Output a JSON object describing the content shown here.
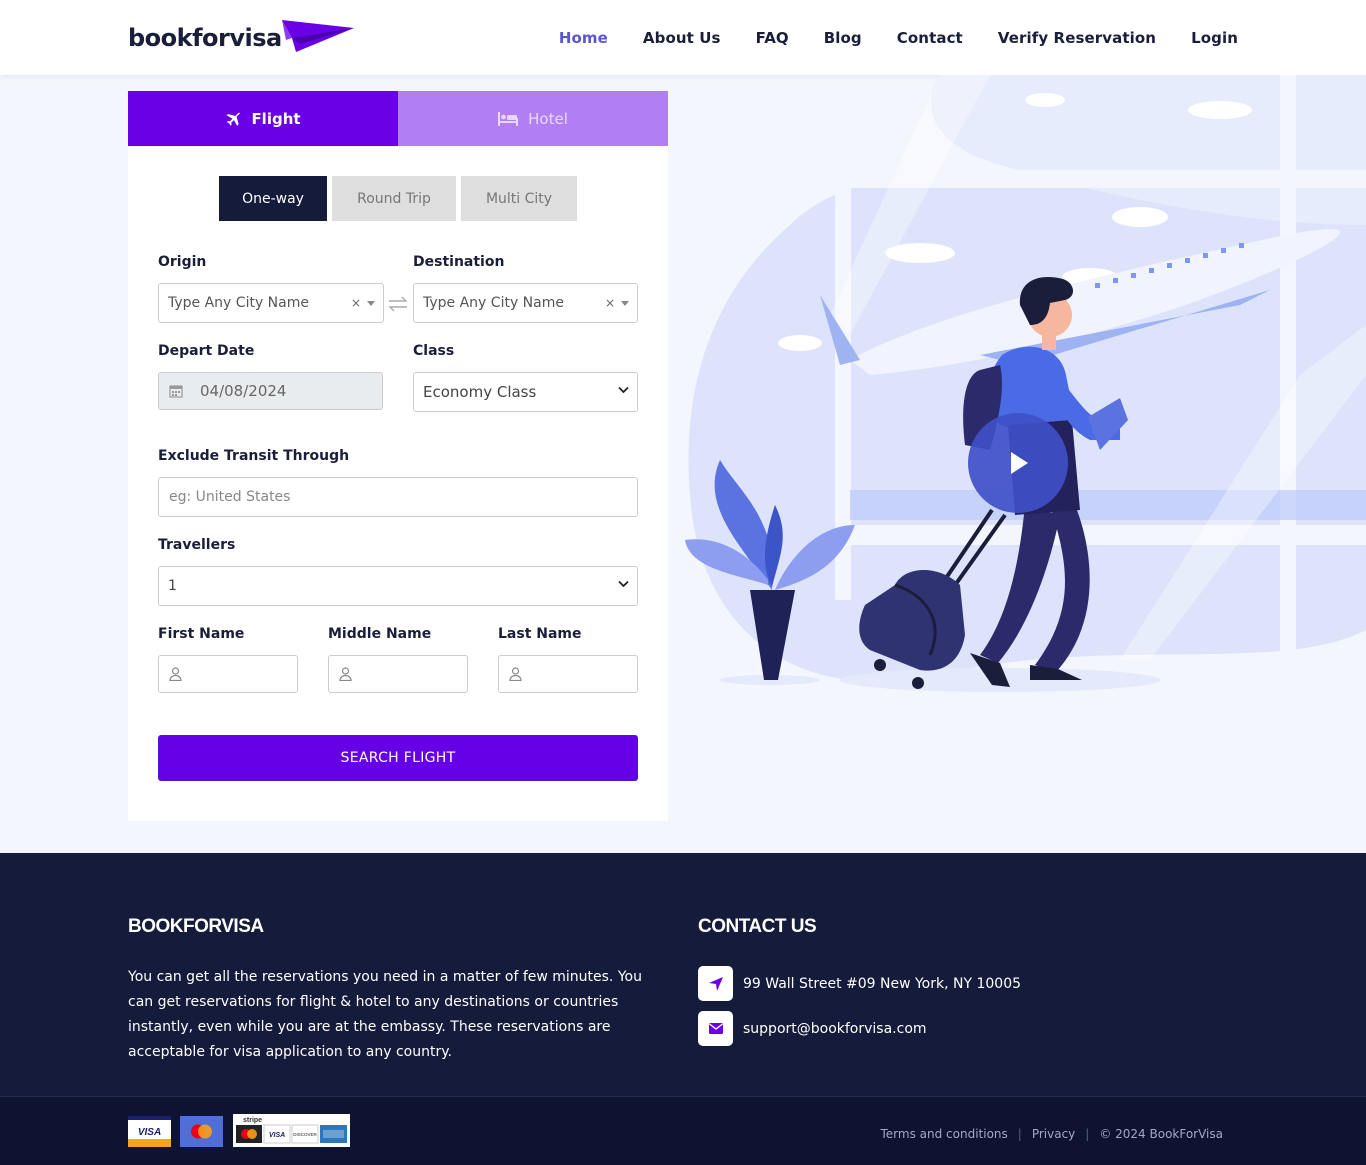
{
  "brand": {
    "name": "bookforvisa"
  },
  "nav": {
    "items": [
      "Home",
      "About Us",
      "FAQ",
      "Blog",
      "Contact",
      "Verify Reservation",
      "Login"
    ],
    "active": "Home"
  },
  "search_form": {
    "mode_tabs": {
      "flight": "Flight",
      "hotel": "Hotel"
    },
    "trip_tabs": {
      "one_way": "One-way",
      "round_trip": "Round Trip",
      "multi_city": "Multi City"
    },
    "origin": {
      "label": "Origin",
      "placeholder": "Type Any City Name"
    },
    "destination": {
      "label": "Destination",
      "placeholder": "Type Any City Name"
    },
    "depart_date": {
      "label": "Depart Date",
      "value": "04/08/2024"
    },
    "class": {
      "label": "Class",
      "value": "Economy Class"
    },
    "exclude_transit": {
      "label": "Exclude Transit Through",
      "placeholder": "eg: United States"
    },
    "travellers": {
      "label": "Travellers",
      "value": "1"
    },
    "first_name": {
      "label": "First Name"
    },
    "middle_name": {
      "label": "Middle Name"
    },
    "last_name": {
      "label": "Last Name"
    },
    "submit_label": "SEARCH FLIGHT"
  },
  "footer": {
    "about_title": "BOOKFORVISA",
    "about_text": "You can get all the reservations you need in a matter of few minutes. You can get reservations for flight & hotel to any destinations or countries instantly, even while you are at the embassy. These reservations are acceptable for visa application to any country.",
    "contact_title": "CONTACT US",
    "address": "99 Wall Street #09 New York, NY 10005",
    "email": "support@bookforvisa.com",
    "payments": {
      "visa": "VISA",
      "stripe": "stripe",
      "stripe_visa": "VISA",
      "stripe_discover": "DISCOVER"
    },
    "links": {
      "terms": "Terms and conditions",
      "privacy": "Privacy",
      "copyright": "© 2024 BookForVisa"
    }
  },
  "colors": {
    "primary": "#6a00e6",
    "hotel_tab": "#b17ff3",
    "navy": "#151b3b",
    "nav_active": "#5b54d8"
  }
}
